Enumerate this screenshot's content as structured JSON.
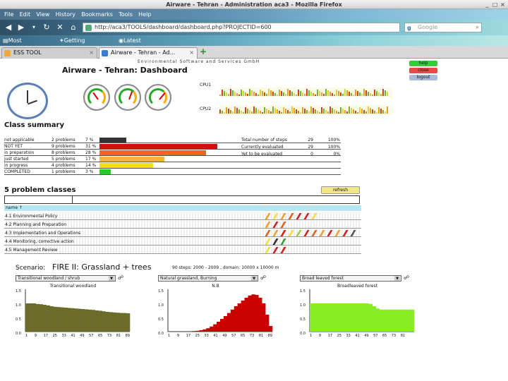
{
  "window": {
    "title": "Airware - Tehran - Administration aca3 - Mozilla Firefox"
  },
  "menu": [
    "File",
    "Edit",
    "View",
    "History",
    "Bookmarks",
    "Tools",
    "Help"
  ],
  "nav": {
    "url": "http://aca3/TOOLS/dashboard/dashboard.php?PROJECTID=600",
    "search_placeholder": "Google"
  },
  "bookmarks": [
    "Most Visited",
    "Getting Started",
    "Latest Headlines"
  ],
  "tabs": [
    {
      "label": "ESS TOOL"
    },
    {
      "label": "Airware - Tehran - Ad..."
    }
  ],
  "header": {
    "company": "Environmental Software and Services GmbH",
    "title": "Airware - Tehran:   Dashboard"
  },
  "side_buttons": [
    {
      "label": "help",
      "color": "#39c939"
    },
    {
      "label": "close",
      "color": "#e84a4a"
    },
    {
      "label": "logout",
      "color": "#a8b8d8"
    }
  ],
  "cpu": {
    "cpu1_label": "CPU1",
    "cpu2_label": "CPU2"
  },
  "summary": {
    "title": "Class summary",
    "rows": [
      {
        "name": "not applicable",
        "problems": "2 problems",
        "pct": "7 %",
        "value": 7,
        "color": "#333333"
      },
      {
        "name": "NOT YET",
        "problems": "9 problems",
        "pct": "31 %",
        "value": 31,
        "color": "#cc1111"
      },
      {
        "name": "in preparation",
        "problems": "8 problems",
        "pct": "28 %",
        "value": 28,
        "color": "#ee6622"
      },
      {
        "name": "just started",
        "problems": "5 problems",
        "pct": "17 %",
        "value": 17,
        "color": "#f5b040"
      },
      {
        "name": "in progress",
        "problems": "4 problems",
        "pct": "14 %",
        "value": 14,
        "color": "#f0e010"
      },
      {
        "name": "COMPLETED",
        "problems": "1 problems",
        "pct": "3 %",
        "value": 3,
        "color": "#22cc22"
      }
    ],
    "stats": [
      {
        "label": "Total number of steps",
        "count": "29",
        "pct": "100%"
      },
      {
        "label": "Currently evaluated",
        "count": "29",
        "pct": "100%"
      },
      {
        "label": "Yet to be evaluated",
        "count": "0",
        "pct": "0%"
      }
    ]
  },
  "problems": {
    "title": "5 problem classes",
    "refresh_label": "refresh",
    "header": "name ↑",
    "rows": [
      {
        "name": "4.1 Environmental Policy",
        "ticks": [
          "#f0a030",
          "#f0e040",
          "#f0a030",
          "#e06020",
          "#cc2222",
          "#cc2222",
          "#f0e040"
        ]
      },
      {
        "name": "4.2 Planning and Preparation",
        "ticks": [
          "#f0a030",
          "#cc2222",
          "#e06020"
        ]
      },
      {
        "name": "4.3 Implementation and Operations",
        "ticks": [
          "#e06020",
          "#f0a030",
          "#cc2222",
          "#f0e040",
          "#9ad040",
          "#cc2222",
          "#e06020",
          "#f0a030",
          "#cc2222",
          "#f0a030",
          "#cc2222",
          "#555555"
        ]
      },
      {
        "name": "4.4 Monitoring, corrective action",
        "ticks": [
          "#f0e040",
          "#333333",
          "#3aa03a"
        ]
      },
      {
        "name": "4.5 Management Review",
        "ticks": [
          "#f0e040",
          "#cc2222",
          "#cc2222"
        ]
      }
    ]
  },
  "scenario": {
    "label": "Scenario:",
    "name": "FIRE II: Grassland + trees",
    "info": "90 steps: 2000 - 2009 , domain: 10000 x 10000 m",
    "selects": [
      "Transitional woodland / shrub",
      "Natural grassland, Burning",
      "Broad leaved forest"
    ]
  },
  "plots": [
    {
      "title": "Transitional woodland",
      "color": "#6b6b2a",
      "values": [
        1.0,
        1.0,
        1.0,
        0.98,
        0.97,
        0.95,
        0.93,
        0.9,
        0.88,
        0.87,
        0.86,
        0.85,
        0.84,
        0.83,
        0.82,
        0.81,
        0.8,
        0.79,
        0.78,
        0.77,
        0.75,
        0.74,
        0.72,
        0.7,
        0.69,
        0.68,
        0.67,
        0.66,
        0.66,
        0.65
      ]
    },
    {
      "title": "N.B",
      "color": "#cc0000",
      "values": [
        0.0,
        0.0,
        0.0,
        0.0,
        0.0,
        0.0,
        0.01,
        0.02,
        0.03,
        0.05,
        0.08,
        0.12,
        0.18,
        0.26,
        0.35,
        0.45,
        0.55,
        0.66,
        0.78,
        0.9,
        1.0,
        1.1,
        1.2,
        1.28,
        1.32,
        1.3,
        1.2,
        1.0,
        0.6,
        0.2
      ]
    },
    {
      "title": "Broadleaved forest",
      "color": "#88ee22",
      "values": [
        1.0,
        1.0,
        1.0,
        1.0,
        1.0,
        1.0,
        1.0,
        1.0,
        1.0,
        1.0,
        1.0,
        1.0,
        1.0,
        1.0,
        1.0,
        1.0,
        1.0,
        0.98,
        0.9,
        0.82,
        0.78,
        0.78,
        0.78,
        0.78,
        0.78,
        0.78,
        0.78,
        0.78,
        0.78,
        0.78
      ]
    }
  ],
  "plot_xticks": [
    "1",
    "9",
    "17",
    "25",
    "33",
    "41",
    "49",
    "57",
    "65",
    "73",
    "81",
    "89"
  ],
  "plot_yticks": [
    "1.5",
    "1.0",
    "0.5",
    "0.0"
  ]
}
